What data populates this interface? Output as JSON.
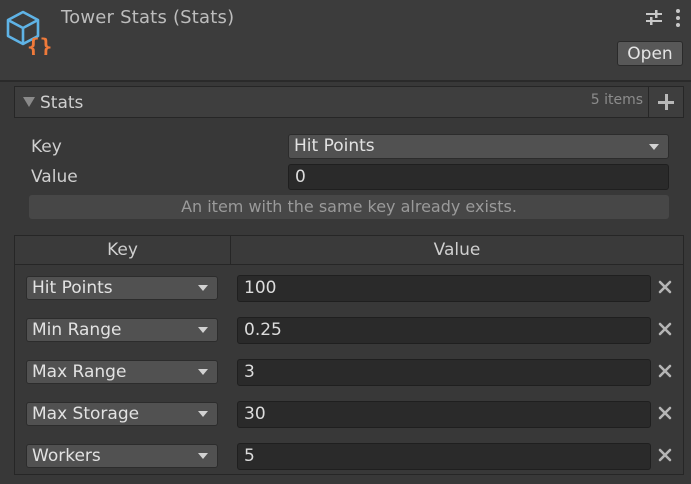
{
  "header": {
    "title": "Tower Stats (Stats)",
    "open_label": "Open",
    "icons": [
      "asset-cube-icon",
      "settings-sliders-icon",
      "more-vertical-icon"
    ]
  },
  "foldout": {
    "title": "Stats",
    "count": "5 items"
  },
  "new_entry": {
    "key_label": "Key",
    "key_value": "Hit Points",
    "value_label": "Value",
    "value_value": "0",
    "warning": "An item with the same key already exists."
  },
  "table": {
    "col_key": "Key",
    "col_value": "Value",
    "rows": [
      {
        "key": "Hit Points",
        "value": "100"
      },
      {
        "key": "Min Range",
        "value": "0.25"
      },
      {
        "key": "Max Range",
        "value": "3"
      },
      {
        "key": "Max Storage",
        "value": "30"
      },
      {
        "key": "Workers",
        "value": "5"
      }
    ]
  },
  "colors": {
    "background": "#383838",
    "icon_cube": "#5fb3e6",
    "icon_braces": "#f07a3a"
  }
}
